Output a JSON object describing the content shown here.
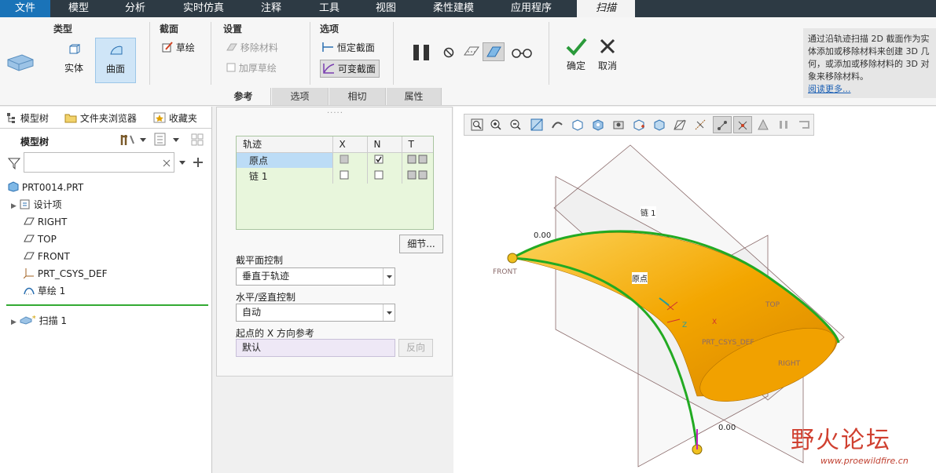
{
  "menu": {
    "items": [
      "文件",
      "模型",
      "分析",
      "实时仿真",
      "注释",
      "工具",
      "视图",
      "柔性建模",
      "应用程序",
      "扫描"
    ]
  },
  "ribbon": {
    "type_group": {
      "title": "类型",
      "solid": "实体",
      "surface": "曲面"
    },
    "section_group": {
      "title": "截面",
      "sketch": "草绘"
    },
    "settings_group": {
      "title": "设置",
      "remove_material": "移除材料",
      "thicken_sketch": "加厚草绘"
    },
    "options_group": {
      "title": "选项",
      "constant_section": "恒定截面",
      "variable_section": "可变截面"
    },
    "ok": "确定",
    "cancel": "取消",
    "subtabs": [
      "参考",
      "选项",
      "相切",
      "属性"
    ],
    "help_text": "通过沿轨迹扫描 2D 截面作为实体添加或移除材料来创建 3D 几何，或添加或移除材料的 3D 对象来移除材料。",
    "help_more": "阅读更多..."
  },
  "left_panel": {
    "tabs": [
      "模型树",
      "文件夹浏览器",
      "收藏夹"
    ],
    "tree_label": "模型树",
    "filter_placeholder": "",
    "items": [
      "PRT0014.PRT",
      "设计项",
      "RIGHT",
      "TOP",
      "FRONT",
      "PRT_CSYS_DEF",
      "草绘 1",
      "扫描 1"
    ]
  },
  "dialog": {
    "table_headers": [
      "轨迹",
      "X",
      "N",
      "T"
    ],
    "rows": [
      {
        "name": "原点",
        "x": "filled",
        "n": "checked",
        "t": "both"
      },
      {
        "name": "链 1",
        "x": "empty",
        "n": "empty",
        "t": "both"
      }
    ],
    "details_btn": "细节...",
    "section_plane_label": "截平面控制",
    "section_plane_value": "垂直于轨迹",
    "hv_label": "水平/竖直控制",
    "hv_value": "自动",
    "xdir_label": "起点的 X 方向参考",
    "xdir_value": "默认",
    "reverse_btn": "反向"
  },
  "viewport": {
    "labels": {
      "chain1": "链 1",
      "origin": "原点",
      "front": "FRONT",
      "top": "TOP",
      "right": "RIGHT",
      "csys": "PRT_CSYS_DEF",
      "dim_top": "0.00",
      "dim_bottom": "0.00",
      "axis_x": "X",
      "axis_z": "Z"
    },
    "surface_color": "#f0a000",
    "trajectory_color": "#22aa22"
  },
  "watermark": {
    "text": "野火论坛",
    "url": "www.proewildfire.cn"
  }
}
